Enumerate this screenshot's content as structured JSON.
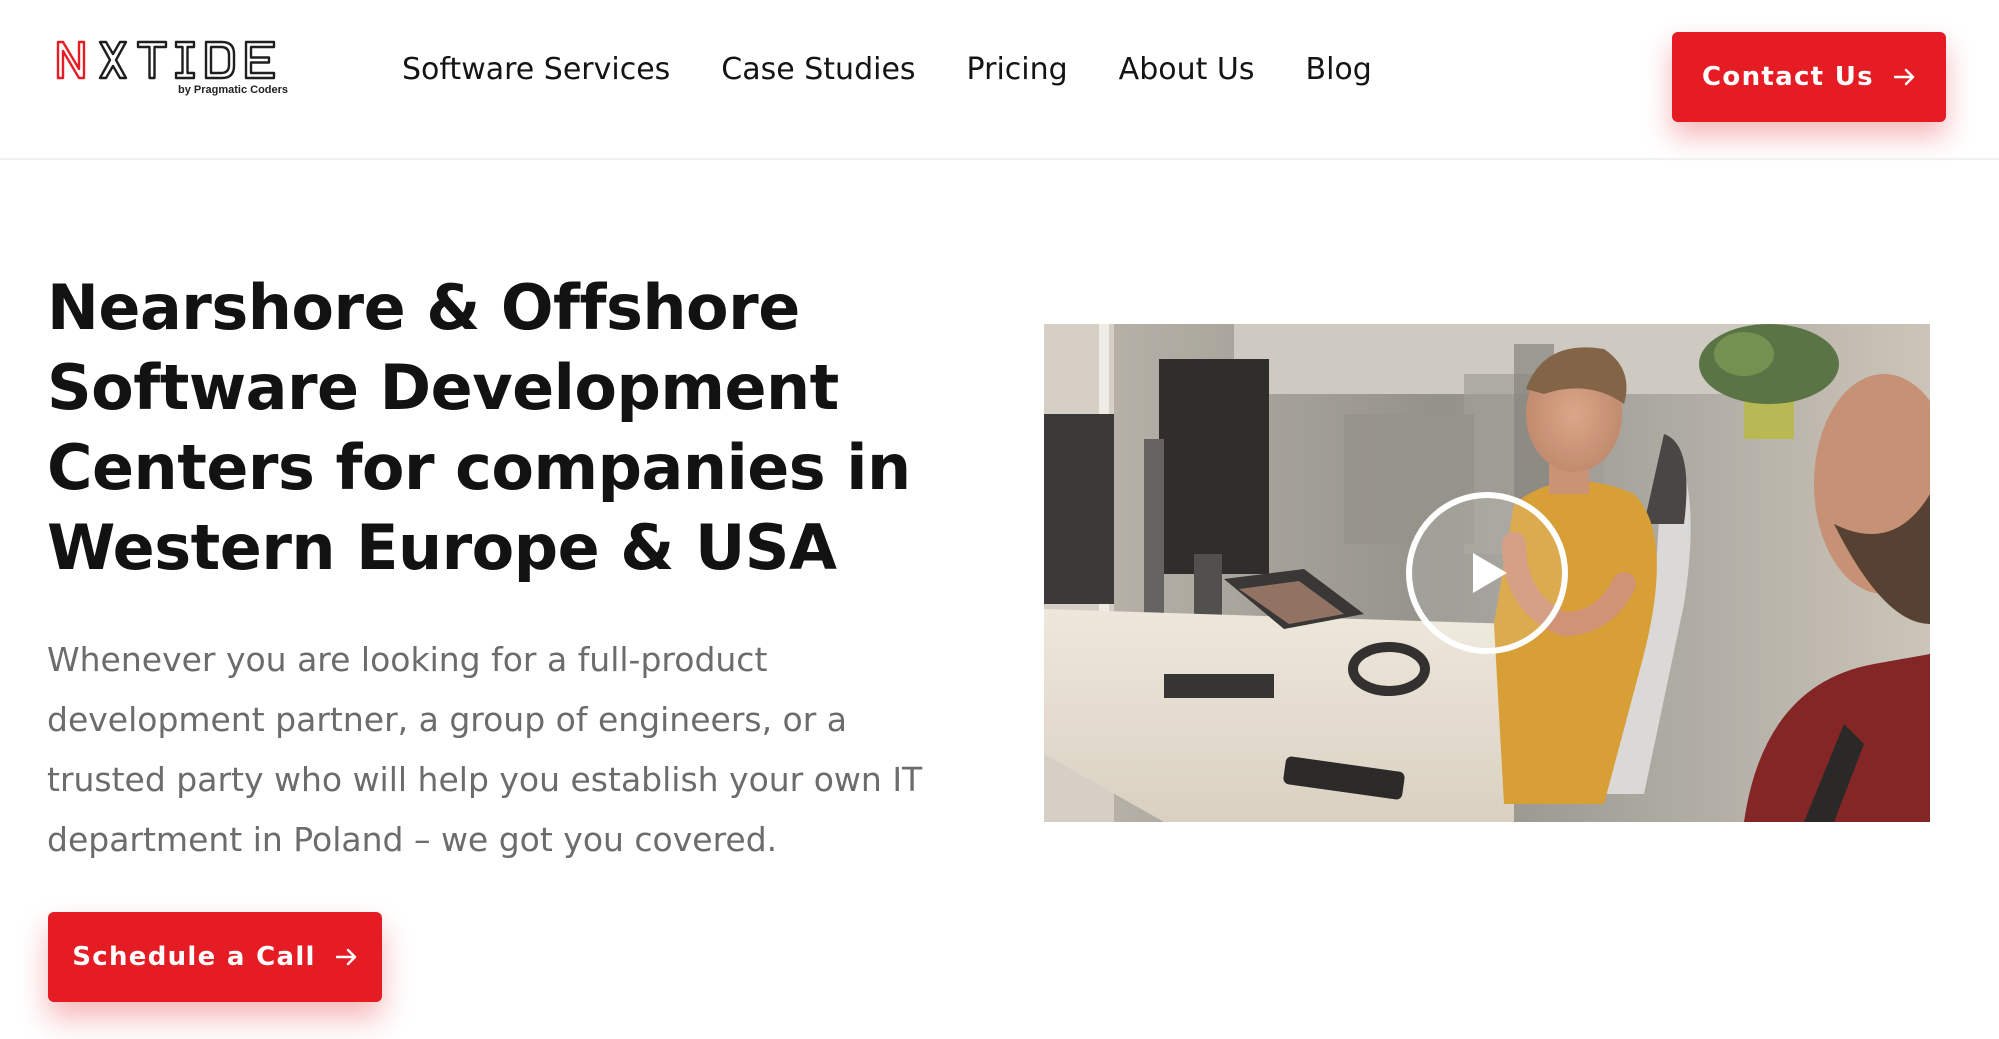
{
  "brand": {
    "logo_text": "NXTIDE",
    "tagline": "by Pragmatic Coders",
    "accent_color": "#e51c23"
  },
  "nav": {
    "items": [
      {
        "label": "Software Services"
      },
      {
        "label": "Case Studies"
      },
      {
        "label": "Pricing"
      },
      {
        "label": "About Us"
      },
      {
        "label": "Blog"
      }
    ]
  },
  "header": {
    "contact_label": "Contact Us",
    "contact_icon": "arrow-right-icon"
  },
  "hero": {
    "title": "Nearshore & Offshore Software Development Centers for companies in Western Europe & USA",
    "description": "Whenever you are looking for a full-product development partner, a group of engineers, or a trusted party who will help you establish your own IT department in Poland – we got you covered.",
    "cta_label": "Schedule a Call",
    "cta_icon": "arrow-right-icon"
  },
  "video": {
    "icon": "play-icon"
  }
}
